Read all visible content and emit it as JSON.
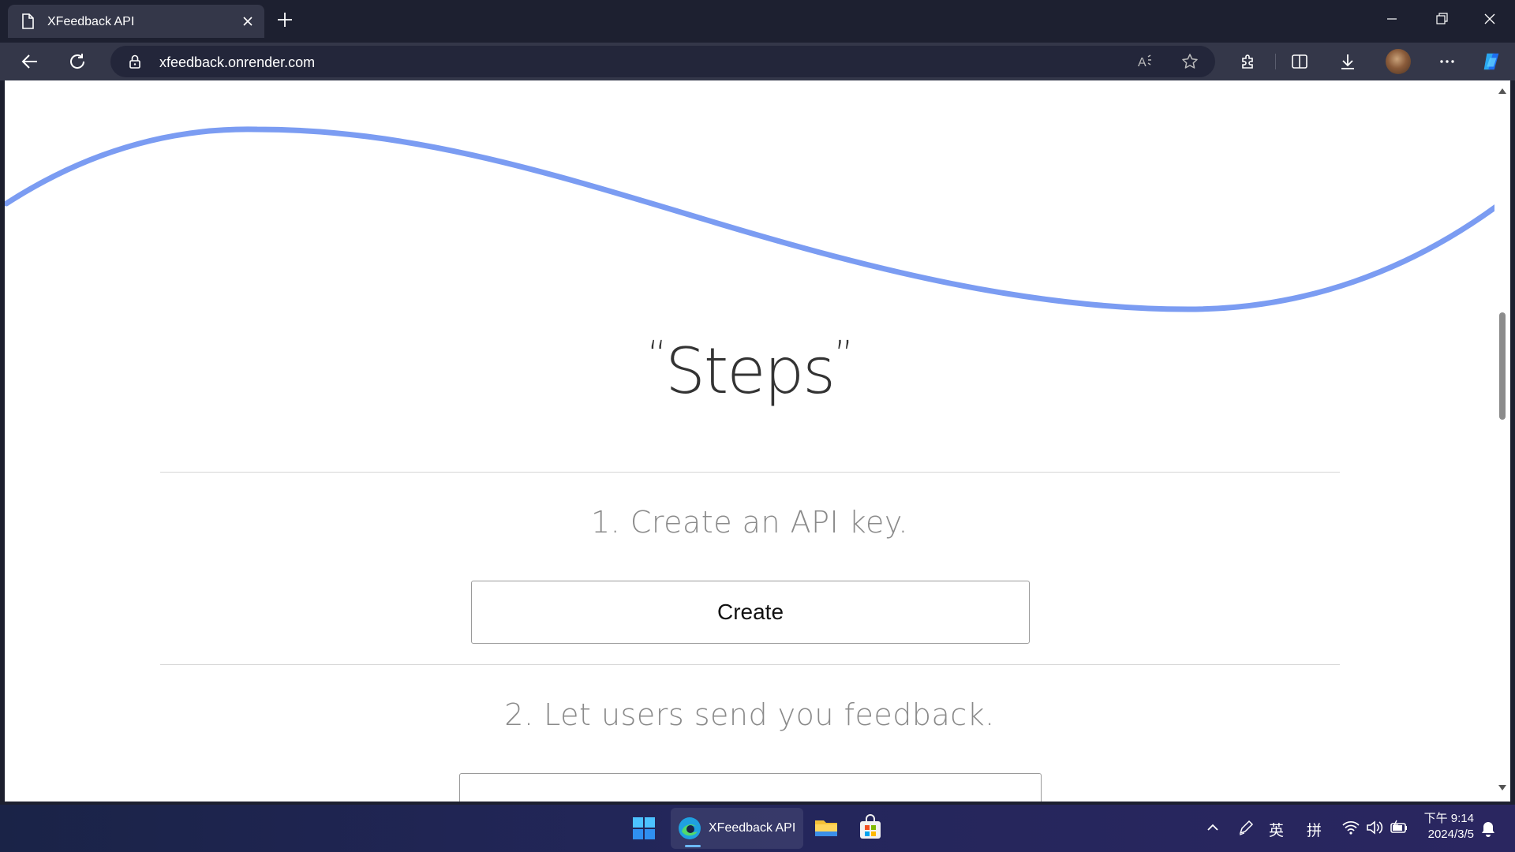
{
  "browser": {
    "tab_title": "XFeedback API",
    "url": "xfeedback.onrender.com",
    "icons": {
      "page": "page-icon",
      "tab_close": "close-icon",
      "new_tab": "plus-icon",
      "back": "back-arrow-icon",
      "reload": "reload-icon",
      "lock": "lock-icon",
      "read_aloud": "read-aloud-icon",
      "favorite": "star-icon",
      "extensions": "puzzle-icon",
      "split": "split-screen-icon",
      "downloads": "download-icon",
      "more": "more-icon",
      "copilot": "copilot-icon"
    }
  },
  "page": {
    "quote_open": "“",
    "heading": "Steps",
    "quote_close": "”",
    "step1_text": "1. Create an API key.",
    "create_button_label": "Create",
    "step2_text": "2. Let users send you feedback.",
    "wave_color": "#7b9cf2"
  },
  "taskbar": {
    "edge_label": "XFeedback API",
    "tray_lang": "英",
    "tray_ime": "拼",
    "clock_time": "下午 9:14",
    "clock_date": "2024/3/5"
  }
}
